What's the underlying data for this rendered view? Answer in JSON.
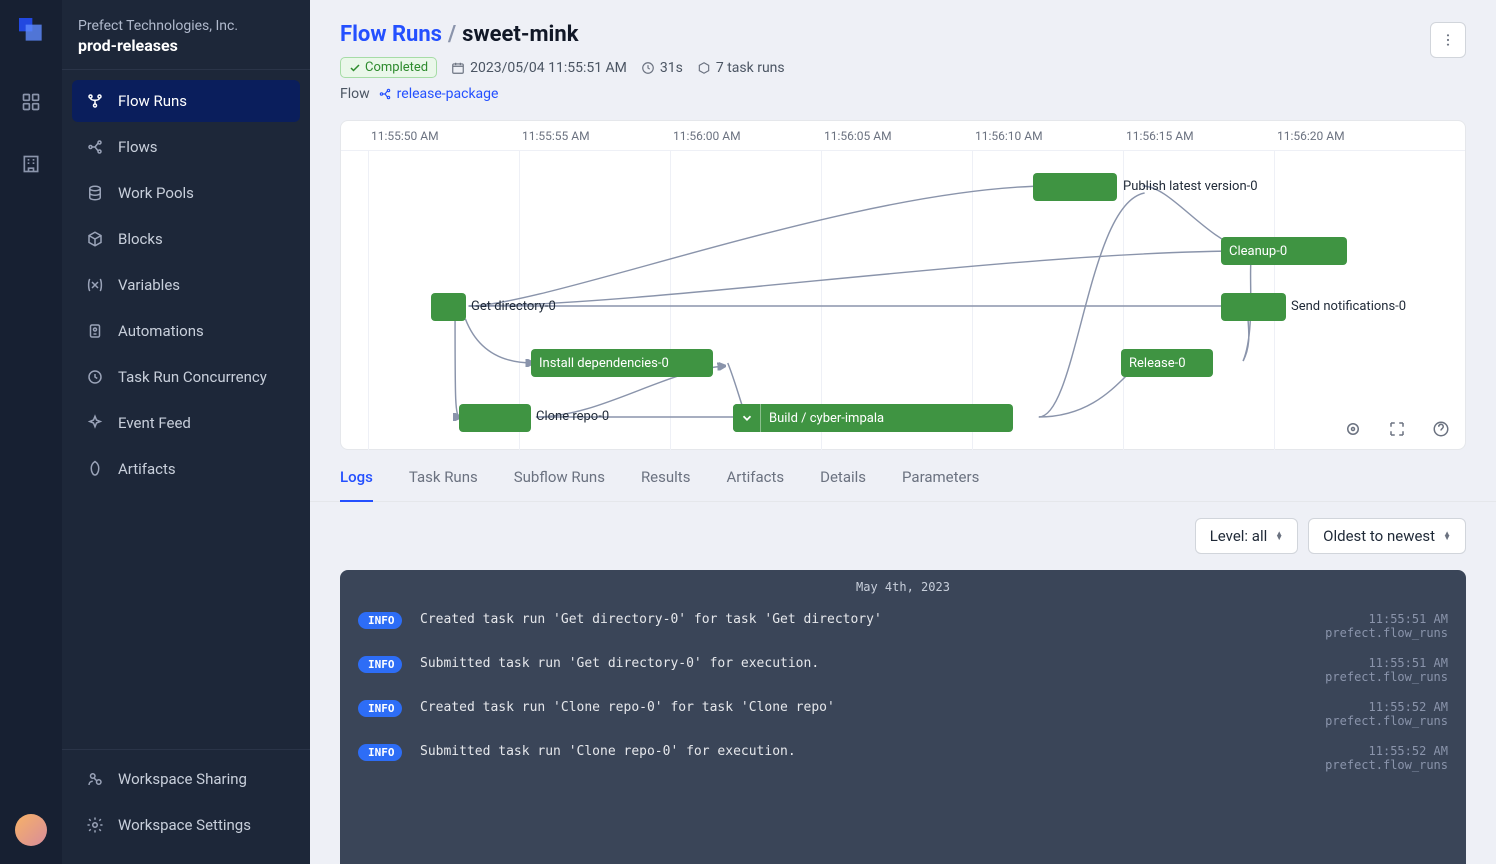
{
  "org": "Prefect Technologies, Inc.",
  "workspace": "prod-releases",
  "nav": {
    "items": [
      {
        "label": "Flow Runs",
        "icon": "flow-runs-icon",
        "active": true
      },
      {
        "label": "Flows",
        "icon": "flows-icon"
      },
      {
        "label": "Work Pools",
        "icon": "database-icon"
      },
      {
        "label": "Blocks",
        "icon": "cube-icon"
      },
      {
        "label": "Variables",
        "icon": "variable-icon"
      },
      {
        "label": "Automations",
        "icon": "automation-icon"
      },
      {
        "label": "Task Run Concurrency",
        "icon": "concurrency-icon"
      },
      {
        "label": "Event Feed",
        "icon": "sparkle-icon"
      },
      {
        "label": "Artifacts",
        "icon": "artifacts-icon"
      }
    ],
    "footer": [
      {
        "label": "Workspace Sharing",
        "icon": "share-icon"
      },
      {
        "label": "Workspace Settings",
        "icon": "gear-icon"
      }
    ]
  },
  "breadcrumb": {
    "root": "Flow Runs",
    "sep": "/",
    "current": "sweet-mink"
  },
  "status": {
    "label": "Completed"
  },
  "meta": {
    "timestamp": "2023/05/04 11:55:51 AM",
    "duration": "31s",
    "task_runs": "7 task runs"
  },
  "flow_label": "Flow",
  "flow_name": "release-package",
  "timeline": {
    "ticks": [
      "11:55:50 AM",
      "11:55:55 AM",
      "11:56:00 AM",
      "11:56:05 AM",
      "11:56:10 AM",
      "11:56:15 AM",
      "11:56:20 AM"
    ],
    "tasks": {
      "get_directory": "Get directory-0",
      "install_dependencies": "Install dependencies-0",
      "clone_repo": "Clone repo-0",
      "build": "Build / cyber-impala",
      "publish": "Publish latest version-0",
      "cleanup": "Cleanup-0",
      "send_notifications": "Send notifications-0",
      "release": "Release-0"
    }
  },
  "tabs": [
    "Logs",
    "Task Runs",
    "Subflow Runs",
    "Results",
    "Artifacts",
    "Details",
    "Parameters"
  ],
  "active_tab": "Logs",
  "filters": {
    "level": "Level: all",
    "sort": "Oldest to newest"
  },
  "logs": {
    "date": "May 4th, 2023",
    "lines": [
      {
        "level": "INFO",
        "msg": "Created task run 'Get directory-0' for task 'Get directory'",
        "time": "11:55:51 AM",
        "src": "prefect.flow_runs"
      },
      {
        "level": "INFO",
        "msg": "Submitted task run 'Get directory-0' for execution.",
        "time": "11:55:51 AM",
        "src": "prefect.flow_runs"
      },
      {
        "level": "INFO",
        "msg": "Created task run 'Clone repo-0' for task 'Clone repo'",
        "time": "11:55:52 AM",
        "src": "prefect.flow_runs"
      },
      {
        "level": "INFO",
        "msg": "Submitted task run 'Clone repo-0' for execution.",
        "time": "11:55:52 AM",
        "src": "prefect.flow_runs"
      }
    ]
  }
}
